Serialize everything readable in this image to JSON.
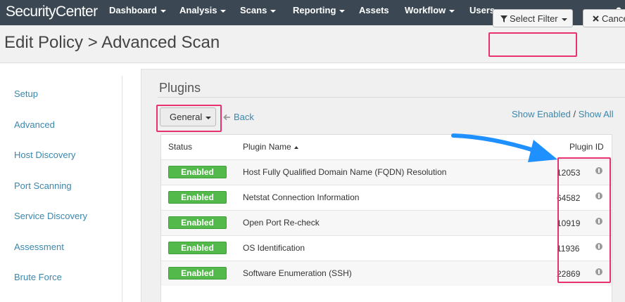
{
  "nav": {
    "brand": "SecurityCenter",
    "items": [
      {
        "label": "Dashboard",
        "dropdown": true
      },
      {
        "label": "Analysis",
        "dropdown": true
      },
      {
        "label": "Scans",
        "dropdown": true
      },
      {
        "label": "Reporting",
        "dropdown": true
      },
      {
        "label": "Assets",
        "dropdown": false
      },
      {
        "label": "Workflow",
        "dropdown": true
      },
      {
        "label": "Users",
        "dropdown": true
      }
    ],
    "user_icon": "user-icon"
  },
  "header": {
    "title": "Edit Policy > Advanced Scan",
    "select_filter": "Select Filter",
    "cancel": "Cance"
  },
  "sidebar": {
    "items": [
      {
        "label": "Setup"
      },
      {
        "label": "Advanced"
      },
      {
        "label": "Host Discovery"
      },
      {
        "label": "Port Scanning"
      },
      {
        "label": "Service Discovery"
      },
      {
        "label": "Assessment"
      },
      {
        "label": "Brute Force"
      }
    ]
  },
  "plugins": {
    "title": "Plugins",
    "family_select": "General",
    "back": "Back",
    "show_enabled": "Show Enabled",
    "separator": "/",
    "show_all": "Show All",
    "columns": {
      "status": "Status",
      "name": "Plugin Name",
      "id": "Plugin ID"
    },
    "rows": [
      {
        "status": "Enabled",
        "name": "Host Fully Qualified Domain Name (FQDN) Resolution",
        "id": "12053"
      },
      {
        "status": "Enabled",
        "name": "Netstat Connection Information",
        "id": "64582"
      },
      {
        "status": "Enabled",
        "name": "Open Port Re-check",
        "id": "10919"
      },
      {
        "status": "Enabled",
        "name": "OS Identification",
        "id": "11936"
      },
      {
        "status": "Enabled",
        "name": "Software Enumeration (SSH)",
        "id": "22869"
      }
    ]
  },
  "colors": {
    "nav_bg": "#3b4853",
    "link": "#3a87ad",
    "enabled_badge": "#53b94b",
    "highlight": "#e8316f",
    "annotation_arrow": "#1e90ff"
  }
}
